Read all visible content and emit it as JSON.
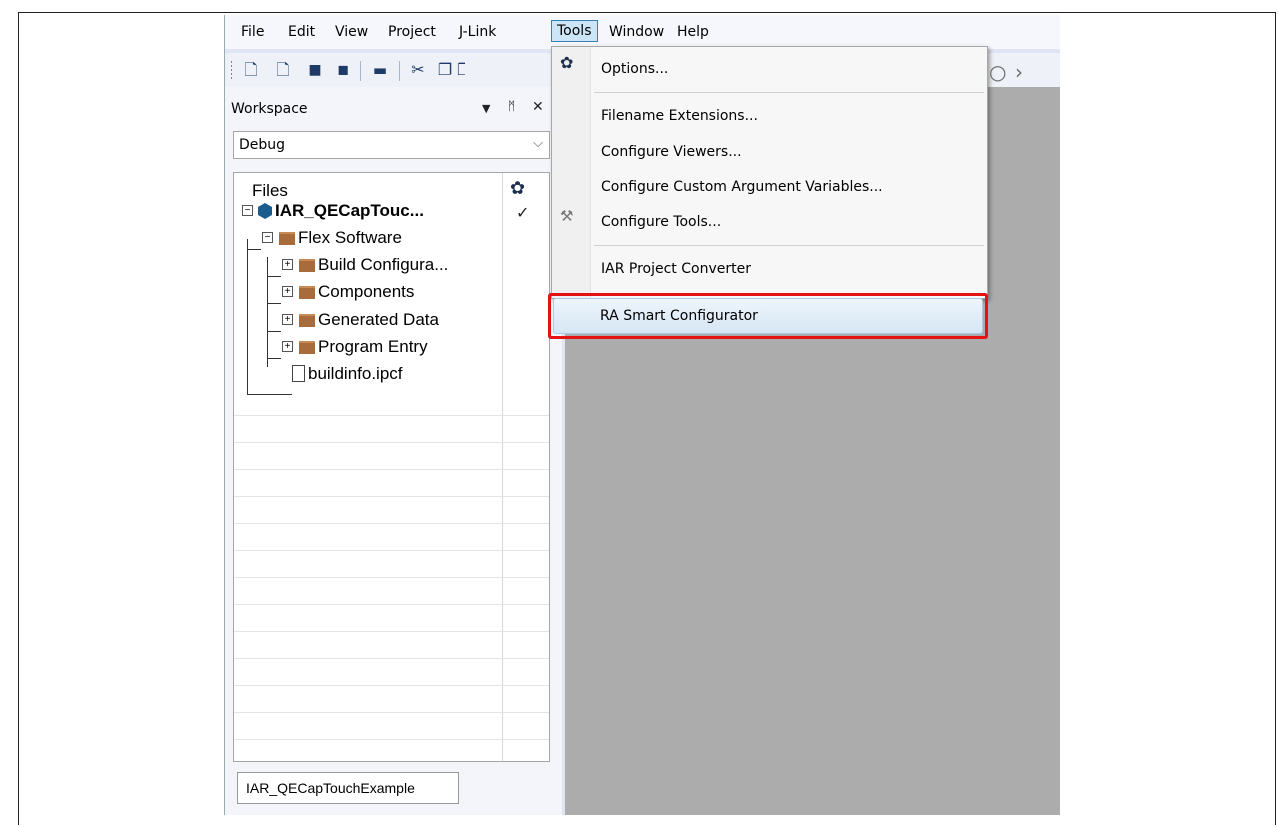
{
  "menubar": {
    "items": [
      "File",
      "Edit",
      "View",
      "Project",
      "J-Link",
      "Tools",
      "Window",
      "Help"
    ],
    "active": "Tools"
  },
  "toolbar": {
    "icons": [
      "new-file-icon",
      "new-doc-icon",
      "save-icon",
      "save-all-icon",
      "print-icon",
      "cut-icon",
      "copy-icon",
      "paste-icon",
      "search-icon",
      "forward-arrow-icon"
    ]
  },
  "workspace": {
    "title": "Workspace",
    "controls": [
      "▼",
      "ᛗ",
      "✕"
    ],
    "configuration": "Debug",
    "files_header": "Files",
    "tree": [
      {
        "label": "IAR_QECapTouc...",
        "type": "project",
        "bold": true,
        "checked": true
      },
      {
        "label": "Flex Software",
        "type": "folder"
      },
      {
        "label": "Build Configura...",
        "type": "folder"
      },
      {
        "label": "Components",
        "type": "folder"
      },
      {
        "label": "Generated Data",
        "type": "folder"
      },
      {
        "label": "Program Entry",
        "type": "folder"
      },
      {
        "label": "buildinfo.ipcf",
        "type": "file"
      }
    ],
    "bottom_tab": "IAR_QECapTouchExample"
  },
  "tools_menu": {
    "items": [
      {
        "label": "Options...",
        "icon": "gear-icon"
      },
      {
        "label": "Filename Extensions..."
      },
      {
        "label": "Configure Viewers..."
      },
      {
        "label": "Configure Custom Argument Variables..."
      },
      {
        "label": "Configure Tools...",
        "icon": "tools-icon"
      },
      {
        "label": "IAR Project Converter"
      },
      {
        "label": "RA Smart Configurator",
        "highlighted": true
      }
    ]
  },
  "colors": {
    "highlight_border": "#e41212",
    "editor_background": "#acacac",
    "active_menu": "#cde6f7"
  }
}
